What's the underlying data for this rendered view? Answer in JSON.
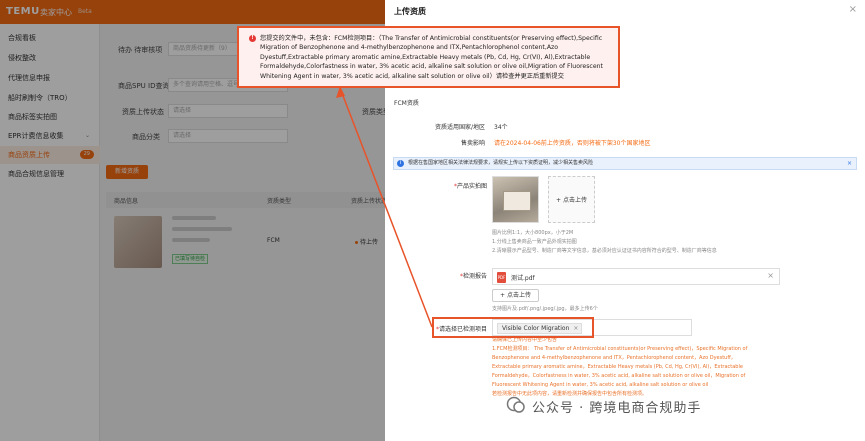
{
  "app": {
    "brand": "TEMU",
    "title": "卖家中心",
    "badge": "Beta"
  },
  "sidebar": {
    "items": [
      {
        "label": "合规看板"
      },
      {
        "label": "侵权整改"
      },
      {
        "label": "代理信息申报"
      },
      {
        "label": "船时刷制令（TRO）"
      },
      {
        "label": "商品标签实拍图"
      },
      {
        "label": "EPR计费信息收集",
        "caret": "⌄"
      },
      {
        "label": "商品资质上传",
        "badge": "29"
      },
      {
        "label": "商品合规信息管理"
      }
    ]
  },
  "filters": {
    "row1_label": "待办 待审核项",
    "row1_value": "商品资质待更新（9）",
    "spu_label": "商品SPU ID查询",
    "spu_placeholder": "多个查询请用空格、逗号分隔",
    "status_label": "资质上传状态",
    "status_placeholder": "请选择",
    "category_label": "商品分类",
    "category_placeholder": "请选择",
    "extra_label": "资质类型"
  },
  "new_button": "新增资质",
  "table": {
    "col_goods": "商品信息",
    "col_type": "资质类型",
    "col_status": "资质上传状态",
    "row": {
      "tag": "已填写待自检",
      "type": "FCM",
      "status": "待上传"
    }
  },
  "drawer": {
    "title": "上传资质",
    "close": "×",
    "section": "FCM资质",
    "region_label": "资质适用国家/地区",
    "region_value": "34个",
    "impact_label": "售卖影响",
    "impact_value": "请在2024-04-06前上传资质，否则将被下架30个国家地区",
    "info_bar": "根据在售国家地区相关法律法规要求，请规实上传以下资质证明，减少相关售卖风险",
    "photo_label": "产品实拍图",
    "photo_upload": "+ 点击上传",
    "photo_hint": [
      "图片比例1:1，大小800px，小于2M",
      "1.分线上售卖商品一致产品外观实拍图",
      "2.清晰展示产品型号、制造厂商等文字信息，基必须对应认证证书内容所符合的型号、制造厂商等信息"
    ],
    "report_label": "检测报告",
    "report_file": "测试.pdf",
    "report_upload": "+ 点击上传",
    "report_hint": "支持图片及.pdf/.png/.jpeg/.jpg，最多上传6个",
    "items_label": "请选择已检测项目",
    "items_chip": "Visible Color Migration",
    "items_note": [
      "请确保已上传内容中至少包含",
      "1.FCM检测项目： The Transfer of Antimicrobial constituents(or Preserving effect)，Specific Migration of",
      "Benzophenone and 4-methylbenzophenone and ITX，Pentachlorophenol content，Azo Dyestuff，",
      "Extractable primary aromatic amine，Extractable Heavy metals (Pb, Cd, Hg, Cr(VI), Al)，Extractable",
      "Formaldehyde，Colorfastness in water, 3% acetic acid, alkaline salt solution or olive oil，Migration of",
      "Fluorescent Whitening Agent in water, 3% acetic acid, alkaline salt solution or olive oil",
      "若检测报告中无此项内容，请重新检测并确保报告中包含所有检测项。"
    ]
  },
  "toast": {
    "message": "您提交的文件中，未包含：FCM检测项目：（The Transfer of Antimicrobial constituents(or Preserving effect),Specific Migration of Benzophenone and 4-methylbenzophenone and ITX,Pentachlorophenol content,Azo Dyestuff,Extractable primary aromatic amine,Extractable Heavy metals (Pb, Cd, Hg, Cr(VI), Al),Extractable Formaldehyde,Colorfastness in water, 3% acetic acid, alkaline salt solution or olive oil,Migration of Fluorescent Whitening Agent in water, 3% acetic acid, alkaline salt solution or olive oil）请检查并更正后重新提交"
  },
  "watermark": "公众号 · 跨境电商合规助手",
  "colors": {
    "accent": "#f46a12",
    "error": "#e8542a",
    "info": "#2f74e0"
  }
}
